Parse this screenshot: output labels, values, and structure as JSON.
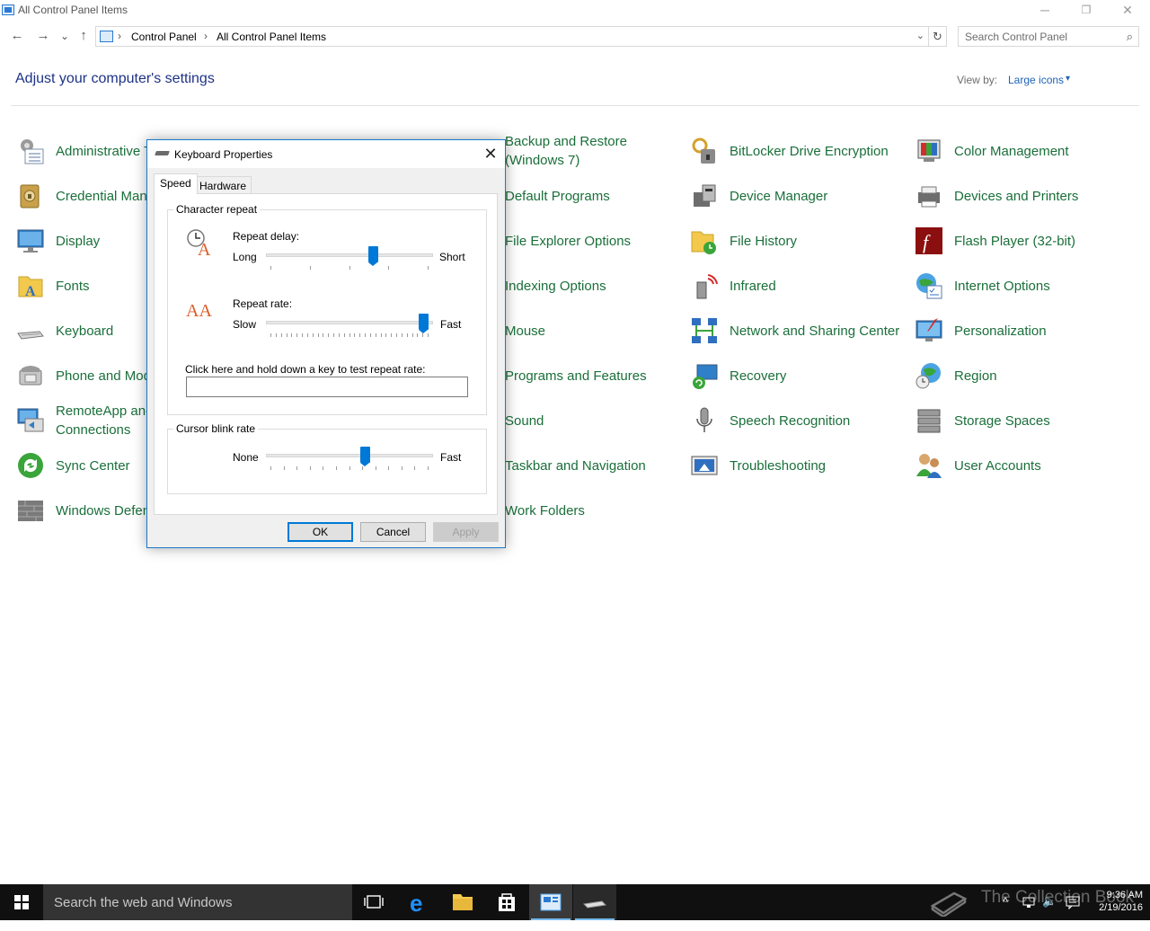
{
  "window": {
    "title": "All Control Panel Items",
    "minimize": "─",
    "restore": "❐",
    "close": "✕"
  },
  "nav": {
    "back": "←",
    "forward": "→",
    "recent": "⌄",
    "up": "↑",
    "breadcrumb": [
      "Control Panel",
      "All Control Panel Items"
    ],
    "breadcrumb_sep": "›",
    "dropdown": "⌄",
    "refresh": "↻",
    "search_placeholder": "Search Control Panel",
    "search_icon": "⌕"
  },
  "header": {
    "title": "Adjust your computer's settings",
    "view_by_label": "View by:",
    "view_by_value": "Large icons",
    "view_by_caret": "▾"
  },
  "items": {
    "col1": [
      "Administrative Tools",
      "Credential Manager",
      "Display",
      "Fonts",
      "Keyboard",
      "Phone and Modem",
      "RemoteApp and Desktop Connections",
      "Sync Center",
      "Windows Defender"
    ],
    "col3": [
      "Backup and Restore (Windows 7)",
      "Default Programs",
      "File Explorer Options",
      "Indexing Options",
      "Mouse",
      "Programs and Features",
      "Sound",
      "Taskbar and Navigation",
      "Work Folders"
    ],
    "col4": [
      "BitLocker Drive Encryption",
      "Device Manager",
      "File History",
      "Infrared",
      "Network and Sharing Center",
      "Recovery",
      "Speech Recognition",
      "Troubleshooting"
    ],
    "col5": [
      "Color Management",
      "Devices and Printers",
      "Flash Player (32-bit)",
      "Internet Options",
      "Personalization",
      "Region",
      "Storage Spaces",
      "User Accounts"
    ]
  },
  "dialog": {
    "title": "Keyboard Properties",
    "close": "✕",
    "tabs": [
      "Speed",
      "Hardware"
    ],
    "character_repeat": {
      "group_title": "Character repeat",
      "repeat_delay": {
        "label": "Repeat delay:",
        "min_label": "Long",
        "max_label": "Short",
        "value_fraction": 0.65
      },
      "repeat_rate": {
        "label": "Repeat rate:",
        "min_label": "Slow",
        "max_label": "Fast",
        "value_fraction": 0.97
      },
      "test_label": "Click here and hold down a key to test repeat rate:",
      "test_value": ""
    },
    "cursor_blink": {
      "group_title": "Cursor blink rate",
      "min_label": "None",
      "max_label": "Fast",
      "value_fraction": 0.6
    },
    "buttons": {
      "ok": "OK",
      "cancel": "Cancel",
      "apply": "Apply"
    }
  },
  "taskbar": {
    "search_placeholder": "Search the web and Windows",
    "time": "9:36 AM",
    "date": "2/19/2016",
    "watermark": "The Collection Book",
    "tray_chevron": "^",
    "volume_icon": "🔈"
  }
}
